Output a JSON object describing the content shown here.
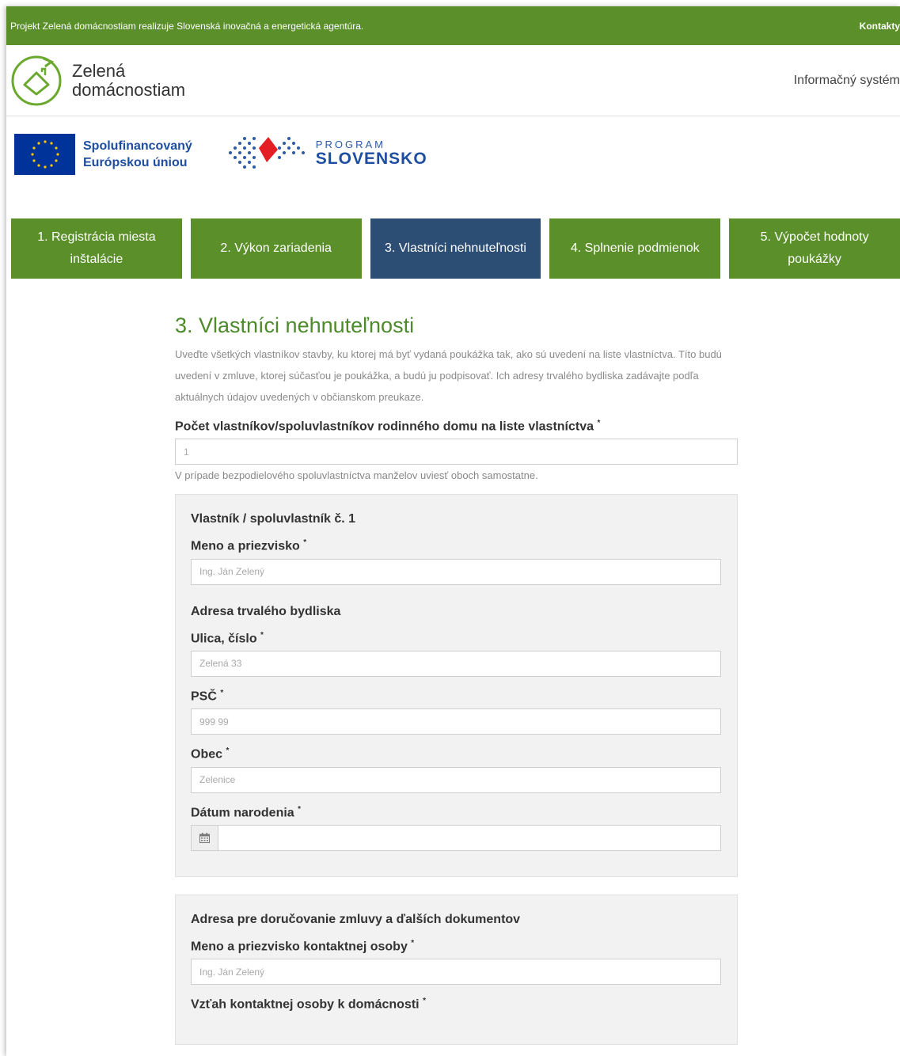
{
  "topbar": {
    "notice": "Projekt Zelená domácnostiam realizuje Slovenská inovačná a energetická agentúra.",
    "contact": "Kontakty"
  },
  "header": {
    "logo_line1": "Zelená",
    "logo_line2": "domácnostiam",
    "infosys": "Informačný systém"
  },
  "partners": {
    "eu_line1": "Spolufinancovaný",
    "eu_line2": "Európskou úniou",
    "program_small": "PROGRAM",
    "program_big": "SLOVENSKO"
  },
  "steps": [
    {
      "label": "1. Registrácia miesta inštalácie",
      "active": false
    },
    {
      "label": "2. Výkon zariadenia",
      "active": false
    },
    {
      "label": "3. Vlastníci nehnuteľnosti",
      "active": true
    },
    {
      "label": "4. Splnenie podmienok",
      "active": false
    },
    {
      "label": "5. Výpočet hodnoty poukážky",
      "active": false
    }
  ],
  "main": {
    "title": "3. Vlastníci nehnuteľnosti",
    "intro": "Uveďte všetkých vlastníkov stavby, ku ktorej má byť vydaná poukážka tak, ako sú uvedení na liste vlastníctva. Títo budú uvedení v zmluve, ktorej súčasťou je poukážka, a budú ju podpisovať. Ich adresy trvalého bydliska zadávajte podľa aktuálnych údajov uvedených v občianskom preukaze.",
    "count_label": "Počet vlastníkov/spoluvlastníkov rodinného domu na liste vlastníctva",
    "count_placeholder": "1",
    "count_hint": "V prípade bezpodielového spoluvlastníctva manželov uviesť oboch samostatne.",
    "required_mark": "*"
  },
  "owner": {
    "title": "Vlastník / spoluvlastník č. 1",
    "name_label": "Meno a priezvisko",
    "name_placeholder": "Ing. Ján Zelený",
    "address_title": "Adresa trvalého bydliska",
    "street_label": "Ulica, číslo",
    "street_placeholder": "Zelená 33",
    "zip_label": "PSČ",
    "zip_placeholder": "999 99",
    "city_label": "Obec",
    "city_placeholder": "Zelenice",
    "birth_label": "Dátum narodenia",
    "calendar_icon": "calendar-icon"
  },
  "delivery": {
    "title": "Adresa pre doručovanie zmluvy a ďalších dokumentov",
    "contact_name_label": "Meno a priezvisko kontaktnej osoby",
    "contact_name_placeholder": "Ing. Ján Zelený",
    "relation_label": "Vzťah kontaktnej osoby k domácnosti"
  },
  "colors": {
    "green": "#5a8f29",
    "active_step": "#2c4d74",
    "title_green": "#4d8a2a"
  }
}
